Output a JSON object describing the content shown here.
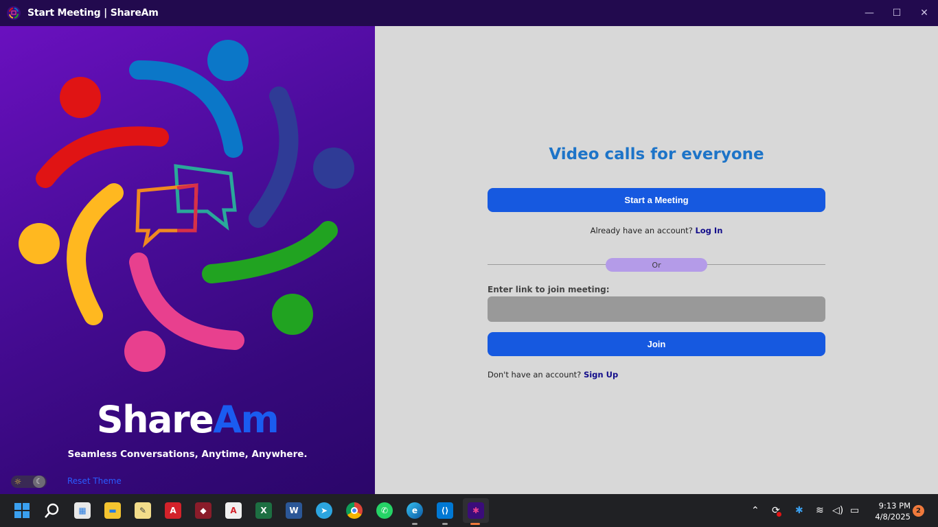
{
  "window": {
    "title": "Start Meeting | ShareAm",
    "app_icon": "shaream-logo-icon",
    "controls": {
      "minimize": "—",
      "maximize": "☐",
      "close": "✕"
    }
  },
  "left_panel": {
    "brand_part1": "Share",
    "brand_part2": "Am",
    "tagline": "Seamless Conversations, Anytime, Anywhere.",
    "reset_theme": "Reset Theme",
    "colors": {
      "red": "#e01414",
      "blue": "#0b77c8",
      "navy": "#2f3b96",
      "yellow": "#ffb820",
      "green": "#21a321",
      "pink": "#e8408e",
      "brand_blue": "#1a5cf0"
    }
  },
  "main": {
    "headline": "Video calls for everyone",
    "start_button": "Start a Meeting",
    "login_prompt": "Already have an account?",
    "login_link": "Log In",
    "or_label": "Or",
    "join_label": "Enter link to join meeting:",
    "join_input_value": "",
    "join_button": "Join",
    "signup_prompt": "Don't have an account?",
    "signup_link": "Sign Up"
  },
  "taskbar": {
    "apps": [
      "start-icon",
      "search-icon",
      "store-icon",
      "file-explorer-icon",
      "notepad-icon",
      "autocad-icon",
      "revit-icon",
      "acrobat-icon",
      "excel-icon",
      "word-icon",
      "telegram-icon",
      "chrome-icon",
      "whatsapp-icon",
      "edge-icon",
      "vscode-icon",
      "shaream-icon"
    ],
    "time": "9:13 PM",
    "date": "4/8/2025",
    "notification_count": "2"
  }
}
